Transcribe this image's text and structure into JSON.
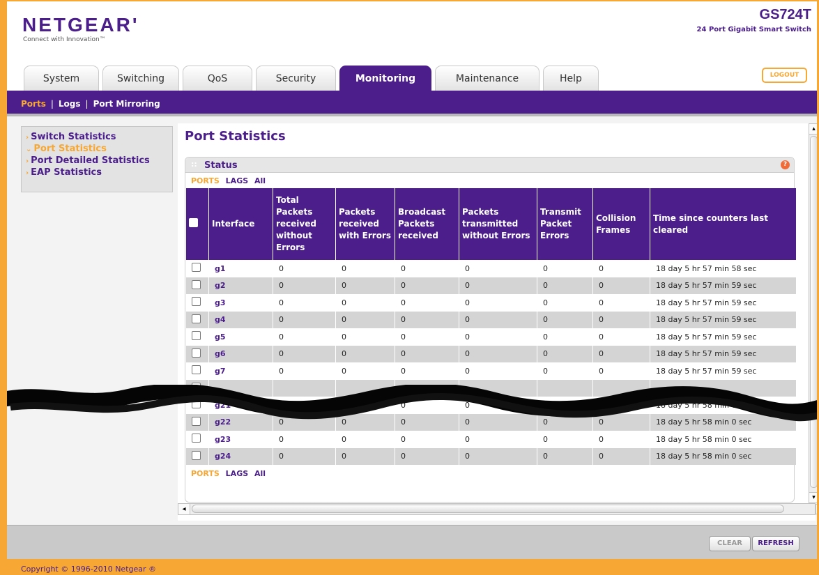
{
  "header": {
    "brand": "NETGEAR",
    "brand_mark": "'",
    "tagline": "Connect with Innovation™",
    "model": "GS724T",
    "model_subtitle": "24 Port Gigabit Smart Switch",
    "logout_label": "LOGOUT"
  },
  "tabs": [
    {
      "label": "System"
    },
    {
      "label": "Switching"
    },
    {
      "label": "QoS"
    },
    {
      "label": "Security"
    },
    {
      "label": "Monitoring"
    },
    {
      "label": "Maintenance"
    },
    {
      "label": "Help"
    }
  ],
  "active_tab": "Monitoring",
  "subnav": {
    "items": [
      "Ports",
      "Logs",
      "Port Mirroring"
    ],
    "separator": "|",
    "active": "Ports"
  },
  "sidebar": {
    "items": [
      {
        "label": "Switch Statistics",
        "state": "collapsed"
      },
      {
        "label": "Port Statistics",
        "state": "expanded"
      },
      {
        "label": "Port Detailed Statistics",
        "state": "collapsed"
      },
      {
        "label": "EAP Statistics",
        "state": "collapsed"
      }
    ],
    "active": "Port Statistics"
  },
  "page": {
    "title": "Port Statistics"
  },
  "panel": {
    "title": "Status",
    "help": "?",
    "filters": {
      "ports": "PORTS",
      "lags": "LAGS",
      "all": "All"
    }
  },
  "table": {
    "headers": {
      "interface": "Interface",
      "rx_ok": "Total Packets received without Errors",
      "rx_err": "Packets received with Errors",
      "bcast": "Broadcast Packets received",
      "tx_ok": "Packets transmitted without Errors",
      "tx_err": "Transmit Packet Errors",
      "coll": "Collision Frames",
      "since": "Time since counters last cleared"
    },
    "rows": [
      {
        "interface": "g1",
        "rx_ok": "0",
        "rx_err": "0",
        "bcast": "0",
        "tx_ok": "0",
        "tx_err": "0",
        "coll": "0",
        "since": "18 day 5 hr 57 min 58 sec"
      },
      {
        "interface": "g2",
        "rx_ok": "0",
        "rx_err": "0",
        "bcast": "0",
        "tx_ok": "0",
        "tx_err": "0",
        "coll": "0",
        "since": "18 day 5 hr 57 min 59 sec"
      },
      {
        "interface": "g3",
        "rx_ok": "0",
        "rx_err": "0",
        "bcast": "0",
        "tx_ok": "0",
        "tx_err": "0",
        "coll": "0",
        "since": "18 day 5 hr 57 min 59 sec"
      },
      {
        "interface": "g4",
        "rx_ok": "0",
        "rx_err": "0",
        "bcast": "0",
        "tx_ok": "0",
        "tx_err": "0",
        "coll": "0",
        "since": "18 day 5 hr 57 min 59 sec"
      },
      {
        "interface": "g5",
        "rx_ok": "0",
        "rx_err": "0",
        "bcast": "0",
        "tx_ok": "0",
        "tx_err": "0",
        "coll": "0",
        "since": "18 day 5 hr 57 min 59 sec"
      },
      {
        "interface": "g6",
        "rx_ok": "0",
        "rx_err": "0",
        "bcast": "0",
        "tx_ok": "0",
        "tx_err": "0",
        "coll": "0",
        "since": "18 day 5 hr 57 min 59 sec"
      },
      {
        "interface": "g7",
        "rx_ok": "0",
        "rx_err": "0",
        "bcast": "0",
        "tx_ok": "0",
        "tx_err": "0",
        "coll": "0",
        "since": "18 day 5 hr 57 min 59 sec"
      },
      {
        "interface": "",
        "rx_ok": "",
        "rx_err": "",
        "bcast": "",
        "tx_ok": "",
        "tx_err": "",
        "coll": "",
        "since": ""
      },
      {
        "interface": "g21",
        "rx_ok": "0",
        "rx_err": "0",
        "bcast": "0",
        "tx_ok": "0",
        "tx_err": "0",
        "coll": "0",
        "since": "18 day 5 hr 58 min 0 sec"
      },
      {
        "interface": "g22",
        "rx_ok": "0",
        "rx_err": "0",
        "bcast": "0",
        "tx_ok": "0",
        "tx_err": "0",
        "coll": "0",
        "since": "18 day 5 hr 58 min 0 sec"
      },
      {
        "interface": "g23",
        "rx_ok": "0",
        "rx_err": "0",
        "bcast": "0",
        "tx_ok": "0",
        "tx_err": "0",
        "coll": "0",
        "since": "18 day 5 hr 58 min 0 sec"
      },
      {
        "interface": "g24",
        "rx_ok": "0",
        "rx_err": "0",
        "bcast": "0",
        "tx_ok": "0",
        "tx_err": "0",
        "coll": "0",
        "since": "18 day 5 hr 58 min 0 sec"
      }
    ]
  },
  "buttons": {
    "clear": "CLEAR",
    "refresh": "REFRESH"
  },
  "footer": {
    "copyright": "Copyright © 1996-2010 Netgear ®"
  },
  "icons": {
    "sidebar_arrow": "chevron-right-icon",
    "sidebar_open": "chevron-down-icon",
    "scroll_left": "arrow-left-icon",
    "scroll_right": "arrow-right-icon",
    "scroll_up": "arrow-up-icon",
    "scroll_down": "arrow-down-icon"
  },
  "colors": {
    "brand_purple": "#4b1e8c",
    "accent_orange": "#f7a733",
    "row_alt": "#d4d4d4"
  }
}
